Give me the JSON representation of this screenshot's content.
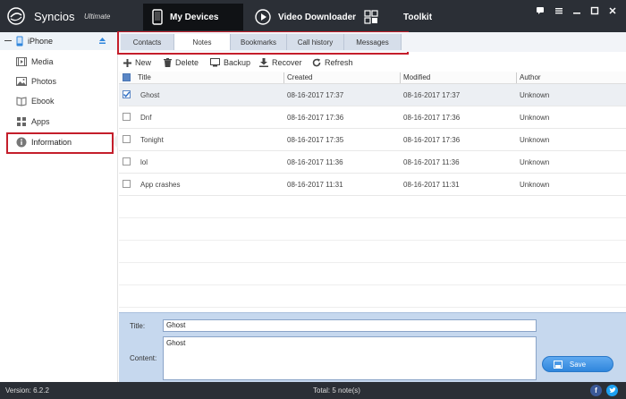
{
  "app": {
    "name": "Syncios",
    "edition": "Ultimate"
  },
  "nav": {
    "tabs": [
      {
        "label": "My Devices",
        "icon": "phone-icon",
        "active": true
      },
      {
        "label": "Video Downloader",
        "icon": "play-icon",
        "active": false
      },
      {
        "label": "Toolkit",
        "icon": "grid-icon",
        "active": false
      }
    ]
  },
  "window_controls": [
    "chat-icon",
    "menu-icon",
    "minimize-icon",
    "maximize-icon",
    "close-icon"
  ],
  "sidebar": {
    "device": {
      "name": "iPhone",
      "icon": "phone-icon"
    },
    "items": [
      {
        "label": "Media",
        "icon": "media-icon"
      },
      {
        "label": "Photos",
        "icon": "photos-icon"
      },
      {
        "label": "Ebook",
        "icon": "ebook-icon"
      },
      {
        "label": "Apps",
        "icon": "apps-icon"
      },
      {
        "label": "Information",
        "icon": "info-icon",
        "active": true
      }
    ]
  },
  "subtabs": [
    {
      "label": "Contacts",
      "active": false
    },
    {
      "label": "Notes",
      "active": true
    },
    {
      "label": "Bookmarks",
      "active": false
    },
    {
      "label": "Call history",
      "active": false
    },
    {
      "label": "Messages",
      "active": false
    }
  ],
  "toolbar": {
    "new_label": "New",
    "delete_label": "Delete",
    "backup_label": "Backup",
    "recover_label": "Recover",
    "refresh_label": "Refresh"
  },
  "table": {
    "columns": [
      "Title",
      "Created",
      "Modified",
      "Author"
    ],
    "rows": [
      {
        "title": "Ghost",
        "created": "08-16-2017 17:37",
        "modified": "08-16-2017 17:37",
        "author": "Unknown",
        "checked": true
      },
      {
        "title": "Dnf",
        "created": "08-16-2017 17:36",
        "modified": "08-16-2017 17:36",
        "author": "Unknown",
        "checked": false
      },
      {
        "title": "Tonight",
        "created": "08-16-2017 17:35",
        "modified": "08-16-2017 17:36",
        "author": "Unknown",
        "checked": false
      },
      {
        "title": "lol",
        "created": "08-16-2017 11:36",
        "modified": "08-16-2017 11:36",
        "author": "Unknown",
        "checked": false
      },
      {
        "title": "App crashes",
        "created": "08-16-2017 11:31",
        "modified": "08-16-2017 11:31",
        "author": "Unknown",
        "checked": false
      }
    ]
  },
  "editor": {
    "title_label": "Title:",
    "title_value": "Ghost",
    "content_label": "Content:",
    "content_value": "Ghost",
    "save_label": "Save"
  },
  "status": {
    "version": "Version: 6.2.2",
    "total": "Total: 5 note(s)"
  },
  "colors": {
    "titlebar": "#2b2f36",
    "accent_blue": "#2f86dc",
    "highlight_red": "#c41e2b",
    "editor_bg": "#c6d8ee"
  }
}
